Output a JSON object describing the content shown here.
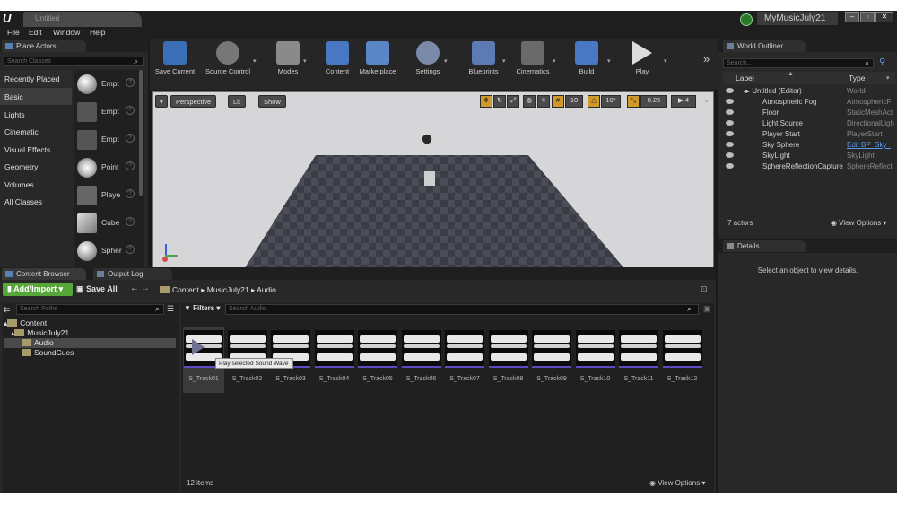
{
  "window": {
    "tab_title": "Untitled",
    "project_name": "MyMusicJuly21",
    "logo": "ue-logo"
  },
  "menu": [
    "File",
    "Edit",
    "Window",
    "Help"
  ],
  "place_actors": {
    "tab_label": "Place Actors",
    "search_placeholder": "Search Classes",
    "categories": [
      "Recently Placed",
      "Basic",
      "Lights",
      "Cinematic",
      "Visual Effects",
      "Geometry",
      "Volumes",
      "All Classes"
    ],
    "selected_category": "Basic",
    "actors": [
      "Empt",
      "Empt",
      "Empt",
      "Point",
      "Playe",
      "Cube",
      "Spher"
    ]
  },
  "toolbar": {
    "buttons": [
      "Save Current",
      "Source Control",
      "Modes",
      "Content",
      "Marketplace",
      "Settings",
      "Blueprints",
      "Cinematics",
      "Build",
      "Play"
    ],
    "overflow": "»"
  },
  "viewport": {
    "view_mode": "Perspective",
    "lighting": "Lit",
    "show": "Show",
    "grid_snap": "10",
    "rotation_snap": "10°",
    "scale_snap": "0.25",
    "camera_speed": "4"
  },
  "world_outliner": {
    "tab_label": "World Outliner",
    "search_placeholder": "Search...",
    "col_label": "Label",
    "col_type": "Type",
    "rows": [
      {
        "label": "Untitled (Editor)",
        "type": "World"
      },
      {
        "label": "Atmospheric Fog",
        "type": "AtmosphericF"
      },
      {
        "label": "Floor",
        "type": "StaticMeshAct"
      },
      {
        "label": "Light Source",
        "type": "DirectionalLigh"
      },
      {
        "label": "Player Start",
        "type": "PlayerStart"
      },
      {
        "label": "Sky Sphere",
        "type": "Edit BP_Sky_"
      },
      {
        "label": "SkyLight",
        "type": "SkyLight"
      },
      {
        "label": "SphereReflectionCapture",
        "type": "SphereReflecti"
      }
    ],
    "actor_count": "7 actors",
    "view_options": "View Options"
  },
  "details": {
    "tab_label": "Details",
    "empty_message": "Select an object to view details."
  },
  "content_browser": {
    "tab_label": "Content Browser",
    "output_log_label": "Output Log",
    "add_import": "Add/Import",
    "save_all": "Save All",
    "breadcrumb": [
      "Content",
      "MusicJuly21",
      "Audio"
    ],
    "search_paths_placeholder": "Search Paths",
    "filters": "Filters",
    "search_placeholder": "Search Audio",
    "tree": [
      "Content",
      "MusicJuly21",
      "Audio",
      "SoundCues"
    ],
    "assets": [
      "S_Track01",
      "S_Track02",
      "S_Track03",
      "S_Track04",
      "S_Track05",
      "S_Track06",
      "S_Track07",
      "S_Track08",
      "S_Track09",
      "S_Track10",
      "S_Track11",
      "S_Track12"
    ],
    "tooltip": "Play selected Sound Wave",
    "item_count": "12 items",
    "view_options": "View Options"
  },
  "colors": {
    "accent_green": "#56a63a",
    "selection_orange": "#d09a2a",
    "audio_purple": "#5c4bc2"
  }
}
